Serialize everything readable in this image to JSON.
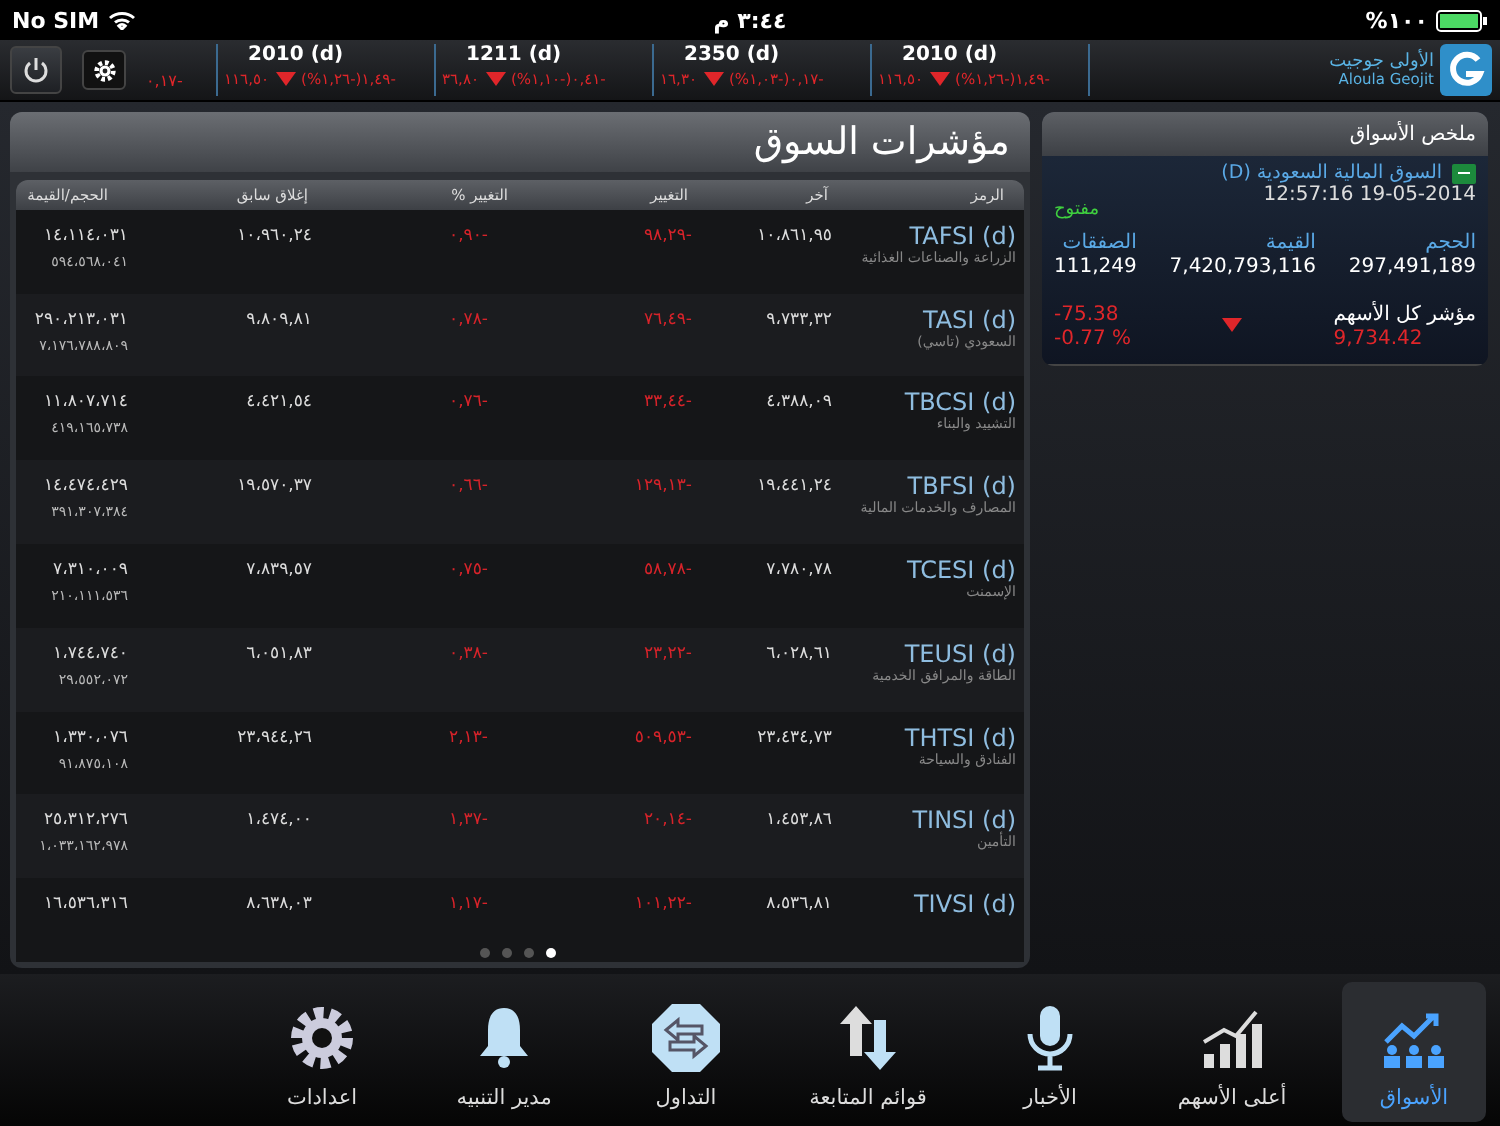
{
  "status_bar": {
    "carrier": "No SIM",
    "time": "٣:٤٤ م",
    "battery": "%١٠٠"
  },
  "ticker": {
    "leading_change": "٠,١٧-",
    "items": [
      {
        "symbol": "2010 (d)",
        "price": "١١٦,٥٠",
        "change": "(%١,٢٦-)١,٤٩-",
        "kind": "down"
      },
      {
        "symbol": "2350 (d)",
        "price": "١٦,٣٠",
        "change": "(%١,٠٣-)٠,١٧-",
        "kind": "down"
      },
      {
        "symbol": "1211 (d)",
        "price": "٣٦,٨٠",
        "change": "(%١,١٠-)٠,٤١-",
        "kind": "down"
      },
      {
        "symbol": "2010 (d)",
        "price": "١١٦,٥٠",
        "change": "(%١,٢٦-)١,٤٩-",
        "kind": "down"
      }
    ],
    "logo": {
      "arabic": "الأولى جوجيت",
      "latin": "Aloula Geojit"
    }
  },
  "indices_panel": {
    "title": "مؤشرات السوق",
    "columns": [
      "الرمز",
      "آخر",
      "التغيير",
      "التغيير %",
      "إغلاق سابق",
      "الحجم/القيمة"
    ],
    "rows": [
      {
        "symbol": "TAFSI (d)",
        "name": "الزراعة والصناعات الغذائية",
        "last": "١٠،٨٦١,٩٥",
        "change": "٩٨,٢٩-",
        "change_pct": "٠,٩٠-",
        "prev_close": "١٠،٩٦٠,٢٤",
        "volume": "١٤،١١٤،٠٣١",
        "value": "٥٩٤،٥٦٨،٠٤١"
      },
      {
        "symbol": "TASI (d)",
        "name": "السعودي (تاسي)",
        "last": "٩،٧٣٣,٣٢",
        "change": "٧٦,٤٩-",
        "change_pct": "٠,٧٨-",
        "prev_close": "٩،٨٠٩,٨١",
        "volume": "٢٩٠،٢١٣،٠٣١",
        "value": "٧،١٧٦،٧٨٨،٨٠٩"
      },
      {
        "symbol": "TBCSI (d)",
        "name": "التشييد والبناء",
        "last": "٤،٣٨٨,٠٩",
        "change": "٣٣,٤٤-",
        "change_pct": "٠,٧٦-",
        "prev_close": "٤،٤٢١,٥٤",
        "volume": "١١،٨٠٧،٧١٤",
        "value": "٤١٩،١٦٥،٧٣٨"
      },
      {
        "symbol": "TBFSI (d)",
        "name": "المصارف والخدمات المالية",
        "last": "١٩،٤٤١,٢٤",
        "change": "١٢٩,١٣-",
        "change_pct": "٠,٦٦-",
        "prev_close": "١٩،٥٧٠,٣٧",
        "volume": "١٤،٤٧٤،٤٢٩",
        "value": "٣٩١،٣٠٧،٣٨٤"
      },
      {
        "symbol": "TCESI (d)",
        "name": "الإسمنت",
        "last": "٧،٧٨٠,٧٨",
        "change": "٥٨,٧٨-",
        "change_pct": "٠,٧٥-",
        "prev_close": "٧،٨٣٩,٥٧",
        "volume": "٧،٣١٠،٠٠٩",
        "value": "٢١٠،١١١،٥٣٦"
      },
      {
        "symbol": "TEUSI (d)",
        "name": "الطاقة والمرافق الخدمية",
        "last": "٦،٠٢٨,٦١",
        "change": "٢٣,٢٢-",
        "change_pct": "٠,٣٨-",
        "prev_close": "٦،٠٥١,٨٣",
        "volume": "١،٧٤٤،٧٤٠",
        "value": "٢٩،٥٥٢،٠٧٢"
      },
      {
        "symbol": "THTSI (d)",
        "name": "الفنادق والسياحة",
        "last": "٢٣،٤٣٤,٧٣",
        "change": "٥٠٩,٥٣-",
        "change_pct": "٢,١٣-",
        "prev_close": "٢٣،٩٤٤,٢٦",
        "volume": "١،٣٣٠،٠٧٦",
        "value": "٩١،٨٧٥،١٠٨"
      },
      {
        "symbol": "TINSI (d)",
        "name": "التأمين",
        "last": "١،٤٥٣,٨٦",
        "change": "٢٠,١٤-",
        "change_pct": "١,٣٧-",
        "prev_close": "١،٤٧٤,٠٠",
        "volume": "٢٥،٣١٢،٢٧٦",
        "value": "١،٠٣٣،١٦٢،٩٧٨"
      },
      {
        "symbol": "TIVSI (d)",
        "last": "٨،٥٣٦,٨١",
        "change": "١٠١,٢٢-",
        "change_pct": "١,١٧-",
        "prev_close": "٨،٦٣٨,٠٣",
        "volume": "١٦،٥٣٦،٣١٦"
      }
    ],
    "page_dots": [
      {
        "selected": false
      },
      {
        "selected": false
      },
      {
        "selected": false
      },
      {
        "selected": true
      }
    ]
  },
  "summary_panel": {
    "title": "ملخص الأسواق",
    "market": "السوق المالية السعودية (D)",
    "datetime": "19-05-2014 12:57:16",
    "status": "مفتوح",
    "stats": [
      {
        "label": "الحجم",
        "value": "297,491,189"
      },
      {
        "label": "القيمة",
        "value": "7,420,793,116"
      },
      {
        "label": "الصفقات",
        "value": "111,249"
      }
    ],
    "index": {
      "name": "مؤشر كل الأسهم",
      "value": "9,734.42",
      "kind": "down",
      "change": "-75.38",
      "change_pct": "-0.77 %"
    }
  },
  "tab_bar": [
    {
      "label": "الأسواق",
      "kind": "markets",
      "selected": true
    },
    {
      "label": "أعلى الأسهم",
      "kind": "bars",
      "selected": false
    },
    {
      "label": "الأخبار",
      "kind": "mic",
      "selected": false
    },
    {
      "label": "قوائم المتابعة",
      "kind": "updown",
      "selected": false
    },
    {
      "label": "التداول",
      "kind": "swap",
      "selected": false
    },
    {
      "label": "مدير التنبيه",
      "kind": "bell",
      "selected": false
    },
    {
      "label": "اعدادات",
      "kind": "gear",
      "selected": false
    }
  ]
}
